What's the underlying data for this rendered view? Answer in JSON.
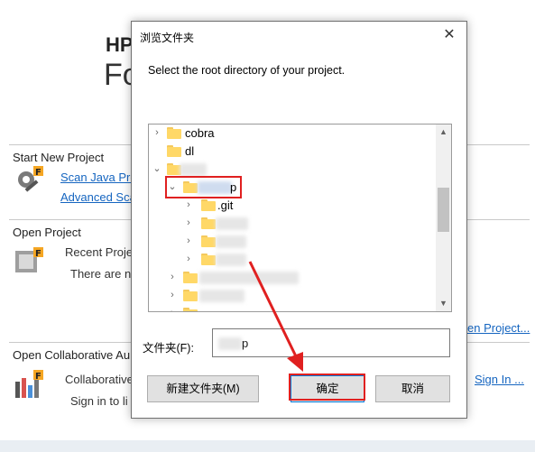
{
  "background": {
    "brand_title": "HP",
    "brand_subtitle": "Fo",
    "start_project": {
      "title": "Start New Project",
      "link_scan": "Scan Java Pro",
      "link_advanced": "Advanced Sca"
    },
    "open_project": {
      "title": "Open Project",
      "recent_label": "Recent Proje",
      "none_label": "There are n",
      "open_link": "en Project..."
    },
    "collab": {
      "title": "Open Collaborative Au",
      "label": "Collaborative",
      "signin_text": "Sign in to li",
      "signin_link": "Sign In ..."
    }
  },
  "dialog": {
    "title": "浏览文件夹",
    "close_glyph": "✕",
    "prompt": "Select the root directory of your project.",
    "tree": {
      "items": [
        {
          "label": "cobra",
          "chevron": "›"
        },
        {
          "label": "dl",
          "chevron": ""
        },
        {
          "label": "",
          "chevron": "⌄"
        },
        {
          "label": "p",
          "chevron": "⌄"
        },
        {
          "label": ".git",
          "chevron": "›"
        },
        {
          "label": "",
          "chevron": "›"
        },
        {
          "label": "",
          "chevron": "›"
        },
        {
          "label": "",
          "chevron": "›"
        },
        {
          "label": "",
          "chevron": "›"
        },
        {
          "label": "",
          "chevron": "›"
        },
        {
          "label": "",
          "chevron": "›"
        }
      ],
      "scroll_up": "▲",
      "scroll_down": "▼"
    },
    "folder_label": "文件夹(F):",
    "folder_value": "p",
    "buttons": {
      "new_folder": "新建文件夹(M)",
      "ok": "确定",
      "cancel": "取消"
    },
    "annotation_color": "#e02020"
  }
}
